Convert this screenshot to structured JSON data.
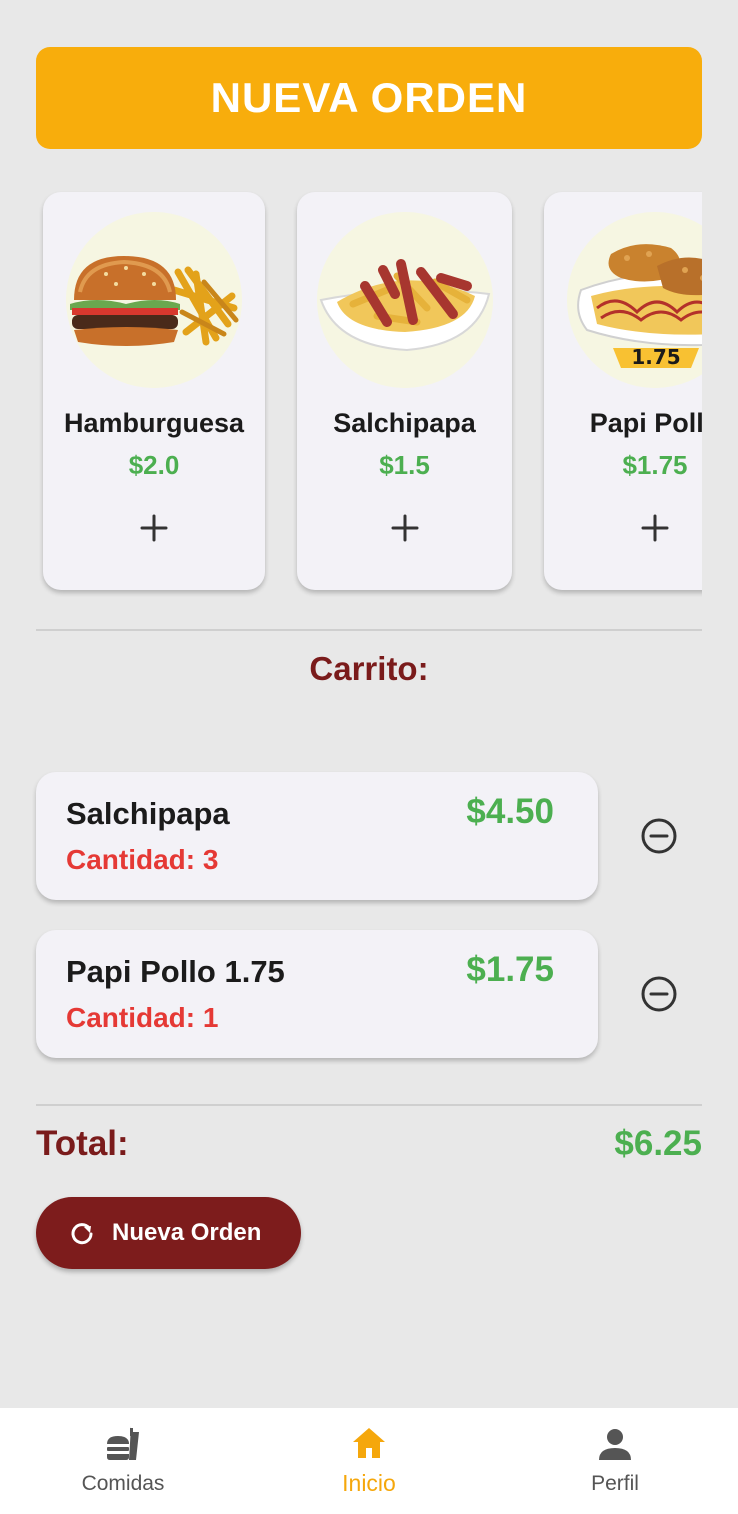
{
  "header": {
    "title": "NUEVA ORDEN"
  },
  "menu": [
    {
      "name": "Hamburguesa",
      "price": "$2.0",
      "image": "burger-fries",
      "add_icon": "plus-icon"
    },
    {
      "name": "Salchipapa",
      "price": "$1.5",
      "image": "sausage-fries",
      "add_icon": "plus-icon"
    },
    {
      "name": "Papi Pollo",
      "price": "$1.75",
      "image": "chicken-fries",
      "badge": "1.75",
      "add_icon": "plus-icon"
    }
  ],
  "cart": {
    "title": "Carrito:",
    "items": [
      {
        "name": "Salchipapa",
        "quantity": "Cantidad: 3",
        "price": "$4.50",
        "remove_icon": "minus-circle-icon"
      },
      {
        "name": "Papi Pollo 1.75",
        "quantity": "Cantidad: 1",
        "price": "$1.75",
        "remove_icon": "minus-circle-icon"
      }
    ],
    "total_label": "Total:",
    "total_value": "$6.25"
  },
  "new_order_button": {
    "label": "Nueva Orden",
    "icon": "refresh-icon"
  },
  "bottom_nav": {
    "items": [
      {
        "label": "Comidas",
        "icon": "fastfood-icon",
        "active": false
      },
      {
        "label": "Inicio",
        "icon": "home-icon",
        "active": true
      },
      {
        "label": "Perfil",
        "icon": "person-icon",
        "active": false
      }
    ]
  },
  "colors": {
    "accent": "#f8ad0c",
    "brand_dark_red": "#7d1c1c",
    "price_green": "#4caf50",
    "quantity_red": "#e53935",
    "background": "#e8e8e8",
    "card": "#f3f2f7"
  }
}
